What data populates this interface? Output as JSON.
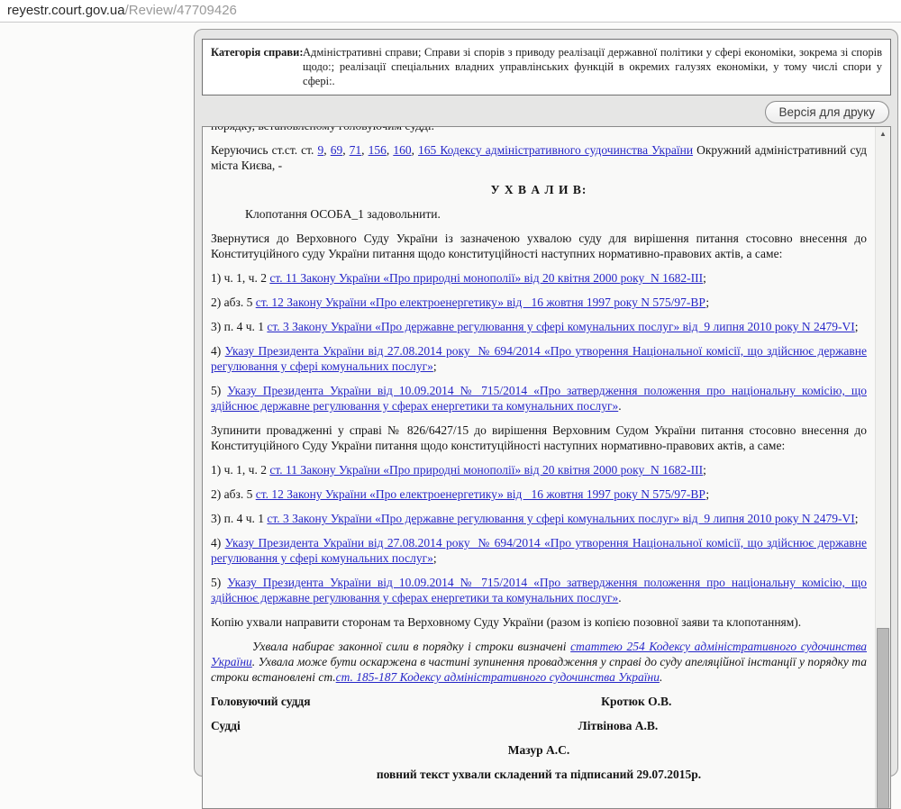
{
  "browser": {
    "url_domain": "reyestr.court.gov.ua",
    "url_path": "/Review/47709426"
  },
  "category": {
    "label": "Категорія справи:",
    "text": "Адміністративні справи; Справи зі спорів з приводу реалізації державної політики у сфері економіки, зокрема зі спорів щодо:; реалізації спеціальних владних управлінських функцій в окремих галузях економіки, у тому числі спори у сфері:."
  },
  "toolbar": {
    "print_button": "Версія для друку"
  },
  "icons": {
    "scrollbar_up": "▲"
  },
  "colors": {
    "link": "#2626c8",
    "panel": "#e6e6e5",
    "doc_bg": "#f9f9f8",
    "text": "#141414"
  },
  "document": {
    "paragraphs": [
      {
        "class": "clipped",
        "name": "clipped-line",
        "segments": [
          {
            "t": "порядку, встановленому головуючим судді."
          }
        ]
      },
      {
        "class": "",
        "name": "paragraph-legal-basis",
        "segments": [
          {
            "t": "Керуючись ст.ст. ст. "
          },
          {
            "t": "9",
            "link": true
          },
          {
            "t": ", "
          },
          {
            "t": "69",
            "link": true
          },
          {
            "t": ", "
          },
          {
            "t": "71",
            "link": true
          },
          {
            "t": ", "
          },
          {
            "t": "156",
            "link": true
          },
          {
            "t": ", "
          },
          {
            "t": "160",
            "link": true
          },
          {
            "t": ", "
          },
          {
            "t": "165 Кодексу адміністративного судочинства України",
            "link": true
          },
          {
            "t": " Окружний адміністративний суд міста Києва, -"
          }
        ]
      },
      {
        "class": "center",
        "name": "ruling-heading",
        "segments": [
          {
            "t": "У Х В А Л И В:"
          }
        ]
      },
      {
        "class": "indent",
        "name": "paragraph-motion",
        "segments": [
          {
            "t": "Клопотання ОСОБА_1 задовольнити."
          }
        ]
      },
      {
        "class": "",
        "name": "paragraph-appeal-supreme-court",
        "segments": [
          {
            "t": "Звернутися до Верховного Суду України із зазначеною ухвалою суду для вирішення питання стосовно внесення до Конституційного суду України питання щодо конституційності наступних нормативно-правових актів, а саме:"
          }
        ]
      },
      {
        "class": "",
        "name": "list-item-1",
        "segments": [
          {
            "t": "1) ч. 1, ч. 2 "
          },
          {
            "t": "ст. 11 Закону України «Про природні монополії» від 20 квітня 2000 року  N 1682-III",
            "link": true
          },
          {
            "t": ";"
          }
        ]
      },
      {
        "class": "",
        "name": "list-item-2",
        "segments": [
          {
            "t": "2) абз. 5 "
          },
          {
            "t": "ст. 12 Закону України «Про електроенергетику» від   16 жовтня 1997 року N 575/97-ВР",
            "link": true
          },
          {
            "t": ";"
          }
        ]
      },
      {
        "class": "",
        "name": "list-item-3",
        "segments": [
          {
            "t": "3) п. 4 ч. 1 "
          },
          {
            "t": "ст. 3 Закону України «Про державне регулювання у сфері комунальних послуг» від  9 липня 2010 року N 2479-VI",
            "link": true
          },
          {
            "t": ";"
          }
        ]
      },
      {
        "class": "",
        "name": "list-item-4",
        "segments": [
          {
            "t": "4) "
          },
          {
            "t": "Указу Президента України від 27.08.2014 року  № 694/2014 «Про утворення Національної комісії, що здійснює державне регулювання у сфері комунальних послуг»",
            "link": true
          },
          {
            "t": ";"
          }
        ]
      },
      {
        "class": "",
        "name": "list-item-5",
        "segments": [
          {
            "t": "5) "
          },
          {
            "t": "Указу Президента України від 10.09.2014 № 715/2014 «Про затвердження положення про національну комісію, що здійснює державне регулювання у сферах енергетики та комунальних послуг»",
            "link": true
          },
          {
            "t": "."
          }
        ]
      },
      {
        "class": "",
        "name": "paragraph-suspend-proceedings",
        "segments": [
          {
            "t": "Зупинити провадженні у справі № 826/6427/15 до вирішення Верховним Судом України питання стосовно внесення до Конституційного Суду України питання щодо конституційності наступних нормативно-правових актів, а саме:"
          }
        ]
      },
      {
        "class": "",
        "name": "list-item-1-repeat",
        "segments": [
          {
            "t": "1) ч. 1, ч. 2 "
          },
          {
            "t": "ст. 11 Закону України «Про природні монополії» від 20 квітня 2000 року  N 1682-III",
            "link": true
          },
          {
            "t": ";"
          }
        ]
      },
      {
        "class": "",
        "name": "list-item-2-repeat",
        "segments": [
          {
            "t": "2) абз. 5 "
          },
          {
            "t": "ст. 12 Закону України «Про електроенергетику» від   16 жовтня 1997 року N 575/97-ВР",
            "link": true
          },
          {
            "t": ";"
          }
        ]
      },
      {
        "class": "",
        "name": "list-item-3-repeat",
        "segments": [
          {
            "t": "3) п. 4 ч. 1 "
          },
          {
            "t": "ст. 3 Закону України «Про державне регулювання у сфері комунальних послуг» від  9 липня 2010 року N 2479-VI",
            "link": true
          },
          {
            "t": ";"
          }
        ]
      },
      {
        "class": "",
        "name": "list-item-4-repeat",
        "segments": [
          {
            "t": "4) "
          },
          {
            "t": "Указу Президента України від 27.08.2014 року  № 694/2014 «Про утворення Національної комісії, що здійснює державне регулювання у сфері комунальних послуг»",
            "link": true
          },
          {
            "t": ";"
          }
        ]
      },
      {
        "class": "",
        "name": "list-item-5-repeat",
        "segments": [
          {
            "t": "5) "
          },
          {
            "t": "Указу Президента України від 10.09.2014 № 715/2014 «Про затвердження положення про національну комісію, що здійснює державне регулювання у сферах енергетики та комунальних послуг»",
            "link": true
          },
          {
            "t": "."
          }
        ]
      },
      {
        "class": "",
        "name": "paragraph-copy-delivery",
        "segments": [
          {
            "t": "Копію ухвали направити сторонам та Верховному Суду України (разом із копією позовної заяви та клопотанням)."
          }
        ]
      },
      {
        "class": "italic",
        "name": "paragraph-legal-force",
        "segments": [
          {
            "t": "Ухвала набирає законної сили в порядку і строки визначені "
          },
          {
            "t": "статтею 254 Кодексу адміністративного судочинства України",
            "link": true
          },
          {
            "t": ". Ухвала може бути оскаржена в частині зупинення провадження у справі до суду апеляційної інстанції у порядку та строки встановлені ст."
          },
          {
            "t": "ст. 185-187 Кодексу адміністративного судочинства України",
            "link": true
          },
          {
            "t": "."
          }
        ]
      },
      {
        "type": "sig",
        "name": "signature-presiding-judge",
        "label": "Головуючий суддя",
        "name_text": "Кротюк О.В.",
        "name_left": "59.5%"
      },
      {
        "type": "sig",
        "name": "signature-judges",
        "label": "Судді",
        "name_text": "Літвінова А.В.",
        "name_left": "56%"
      },
      {
        "class": "sigc",
        "name": "signature-judge-mazur",
        "segments": [
          {
            "t": "Мазур А.С."
          }
        ]
      },
      {
        "class": "sigc",
        "name": "full-text-date-note",
        "segments": [
          {
            "t": "повний текст ухвали складений та підписаний 29.07.2015р."
          }
        ]
      }
    ]
  }
}
